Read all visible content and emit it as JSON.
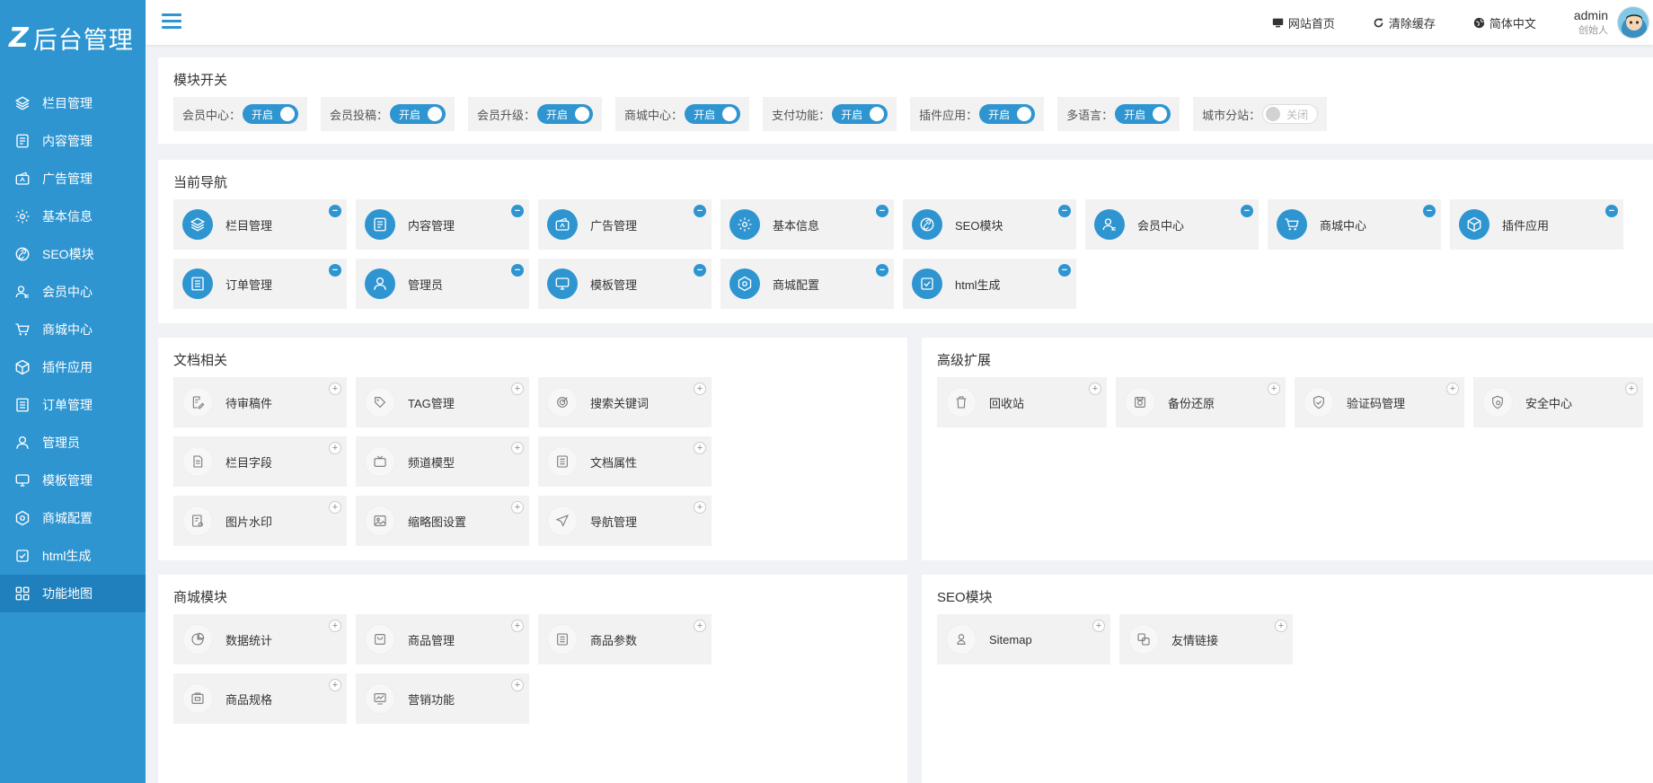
{
  "brand": {
    "mark": "Z",
    "title": "后台管理"
  },
  "sidebar": {
    "items": [
      {
        "label": "栏目管理",
        "icon": "layers-icon"
      },
      {
        "label": "内容管理",
        "icon": "document-icon"
      },
      {
        "label": "广告管理",
        "icon": "ad-icon"
      },
      {
        "label": "基本信息",
        "icon": "gear-icon"
      },
      {
        "label": "SEO模块",
        "icon": "link-icon"
      },
      {
        "label": "会员中心",
        "icon": "user-icon"
      },
      {
        "label": "商城中心",
        "icon": "cart-icon"
      },
      {
        "label": "插件应用",
        "icon": "cube-icon"
      },
      {
        "label": "订单管理",
        "icon": "list-icon"
      },
      {
        "label": "管理员",
        "icon": "person-icon"
      },
      {
        "label": "模板管理",
        "icon": "monitor-icon"
      },
      {
        "label": "商城配置",
        "icon": "hex-gear-icon"
      },
      {
        "label": "html生成",
        "icon": "check-square-icon"
      },
      {
        "label": "功能地图",
        "icon": "grid-icon",
        "active": true
      }
    ]
  },
  "header": {
    "links": [
      {
        "label": "网站首页",
        "icon": "monitor-icon"
      },
      {
        "label": "清除缓存",
        "icon": "refresh-icon"
      },
      {
        "label": "简体中文",
        "icon": "globe-icon"
      }
    ],
    "user": {
      "name": "admin",
      "role": "创始人"
    }
  },
  "switch_panel": {
    "title": "模块开关",
    "items": [
      {
        "label": "会员中心：",
        "state": "开启",
        "on": true
      },
      {
        "label": "会员投稿：",
        "state": "开启",
        "on": true
      },
      {
        "label": "会员升级：",
        "state": "开启",
        "on": true
      },
      {
        "label": "商城中心：",
        "state": "开启",
        "on": true
      },
      {
        "label": "支付功能：",
        "state": "开启",
        "on": true
      },
      {
        "label": "插件应用：",
        "state": "开启",
        "on": true
      },
      {
        "label": "多语言：",
        "state": "开启",
        "on": true
      },
      {
        "label": "城市分站：",
        "state": "关闭",
        "on": false
      }
    ]
  },
  "nav_panel": {
    "title": "当前导航",
    "items": [
      {
        "label": "栏目管理",
        "icon": "layers-icon"
      },
      {
        "label": "内容管理",
        "icon": "document-icon"
      },
      {
        "label": "广告管理",
        "icon": "ad-icon"
      },
      {
        "label": "基本信息",
        "icon": "gear-icon"
      },
      {
        "label": "SEO模块",
        "icon": "link-icon"
      },
      {
        "label": "会员中心",
        "icon": "user-icon"
      },
      {
        "label": "商城中心",
        "icon": "cart-icon"
      },
      {
        "label": "插件应用",
        "icon": "cube-icon"
      },
      {
        "label": "订单管理",
        "icon": "list-icon"
      },
      {
        "label": "管理员",
        "icon": "person-icon"
      },
      {
        "label": "模板管理",
        "icon": "monitor-icon"
      },
      {
        "label": "商城配置",
        "icon": "hex-gear-icon"
      },
      {
        "label": "html生成",
        "icon": "check-square-icon"
      }
    ]
  },
  "doc_panel": {
    "title": "文档相关",
    "items": [
      {
        "label": "待审稿件",
        "icon": "edit-icon"
      },
      {
        "label": "TAG管理",
        "icon": "tag-icon"
      },
      {
        "label": "搜索关键词",
        "icon": "target-icon"
      },
      {
        "label": "栏目字段",
        "icon": "file-icon"
      },
      {
        "label": "频道模型",
        "icon": "tv-icon"
      },
      {
        "label": "文档属性",
        "icon": "lines-icon"
      },
      {
        "label": "图片水印",
        "icon": "image-icon"
      },
      {
        "label": "缩略图设置",
        "icon": "picture-icon"
      },
      {
        "label": "导航管理",
        "icon": "send-icon"
      }
    ]
  },
  "adv_panel": {
    "title": "高级扩展",
    "items": [
      {
        "label": "回收站",
        "icon": "trash-icon"
      },
      {
        "label": "备份还原",
        "icon": "backup-icon"
      },
      {
        "label": "验证码管理",
        "icon": "shield-icon"
      },
      {
        "label": "安全中心",
        "icon": "security-icon"
      }
    ]
  },
  "shop_panel": {
    "title": "商城模块",
    "items": [
      {
        "label": "数据统计",
        "icon": "pie-icon"
      },
      {
        "label": "商品管理",
        "icon": "bag-icon"
      },
      {
        "label": "商品参数",
        "icon": "lines-icon"
      },
      {
        "label": "商品规格",
        "icon": "box-icon"
      },
      {
        "label": "营销功能",
        "icon": "chart-icon"
      }
    ]
  },
  "seo_panel": {
    "title": "SEO模块",
    "items": [
      {
        "label": "Sitemap",
        "icon": "sitemap-icon"
      },
      {
        "label": "友情链接",
        "icon": "chain-icon"
      }
    ]
  },
  "colors": {
    "primary": "#2e95d1",
    "active_menu": "#2080bd",
    "tile_bg": "#f2f2f2"
  }
}
